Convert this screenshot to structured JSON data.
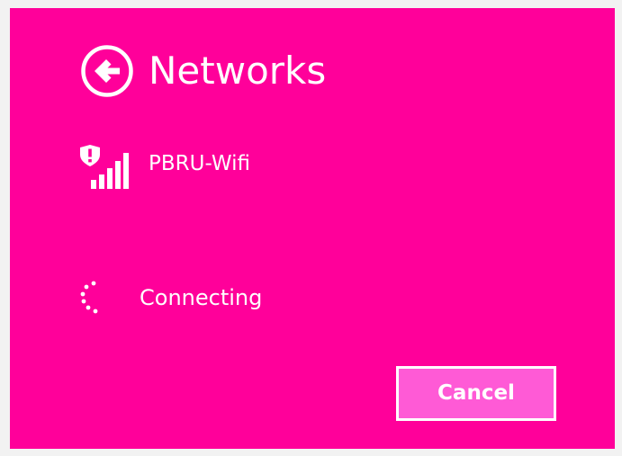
{
  "header": {
    "title": "Networks",
    "back_icon": "back-arrow-circle-icon"
  },
  "network": {
    "name": "PBRU-Wifi",
    "icon": "wifi-signal-shield-warning-icon",
    "signal_bars": 5
  },
  "status": {
    "text": "Connecting",
    "icon": "spinner-icon"
  },
  "actions": {
    "cancel_label": "Cancel"
  },
  "colors": {
    "panel_background": "#ff009a",
    "button_background": "#ff5ad6",
    "foreground": "#ffffff"
  }
}
